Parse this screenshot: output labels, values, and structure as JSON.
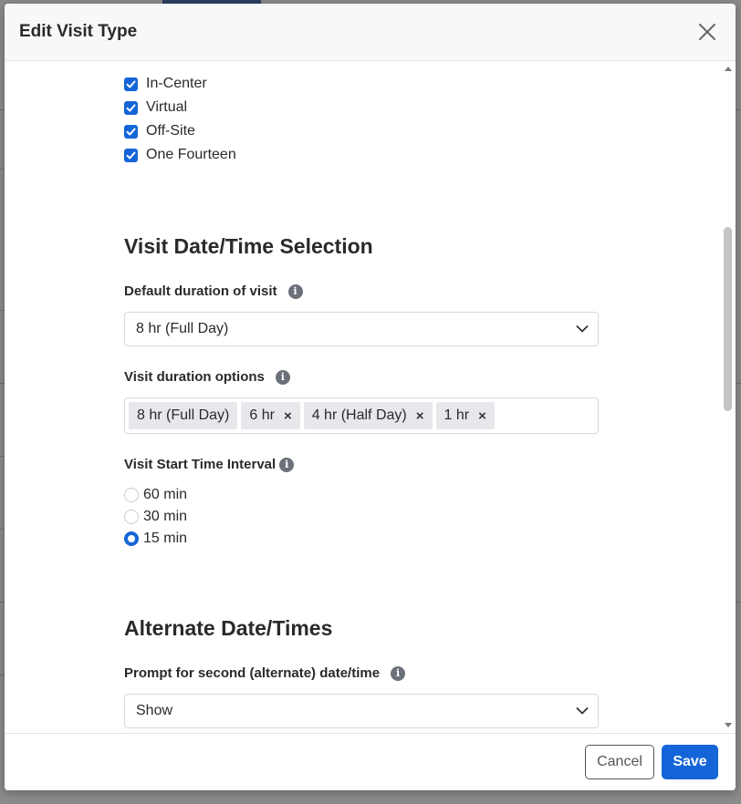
{
  "modal": {
    "title": "Edit Visit Type"
  },
  "locations": [
    {
      "label": "In-Center",
      "checked": true
    },
    {
      "label": "Virtual",
      "checked": true
    },
    {
      "label": "Off-Site",
      "checked": true
    },
    {
      "label": "One Fourteen",
      "checked": true
    }
  ],
  "date_time_section": {
    "title": "Visit Date/Time Selection",
    "default_duration_label": "Default duration of visit",
    "default_duration_value": "8 hr (Full Day)",
    "duration_options_label": "Visit duration options",
    "duration_options": [
      {
        "label": "8 hr (Full Day)",
        "removable": false
      },
      {
        "label": "6 hr",
        "removable": true
      },
      {
        "label": "4 hr (Half Day)",
        "removable": true
      },
      {
        "label": "1 hr",
        "removable": true
      }
    ],
    "interval_label": "Visit Start Time Interval",
    "intervals": [
      {
        "label": "60 min",
        "selected": false
      },
      {
        "label": "30 min",
        "selected": false
      },
      {
        "label": "15 min",
        "selected": true
      }
    ]
  },
  "alternate_section": {
    "title": "Alternate Date/Times",
    "prompt_label": "Prompt for second (alternate) date/time",
    "prompt_value": "Show"
  },
  "footer": {
    "cancel_label": "Cancel",
    "save_label": "Save"
  },
  "colors": {
    "accent": "#1565d8",
    "info_icon": "#6b7079"
  },
  "icons": {
    "close": "close-icon",
    "check": "checkmark-icon",
    "info": "info-icon",
    "chevron": "chevron-down-icon",
    "remove": "remove-x-icon"
  }
}
